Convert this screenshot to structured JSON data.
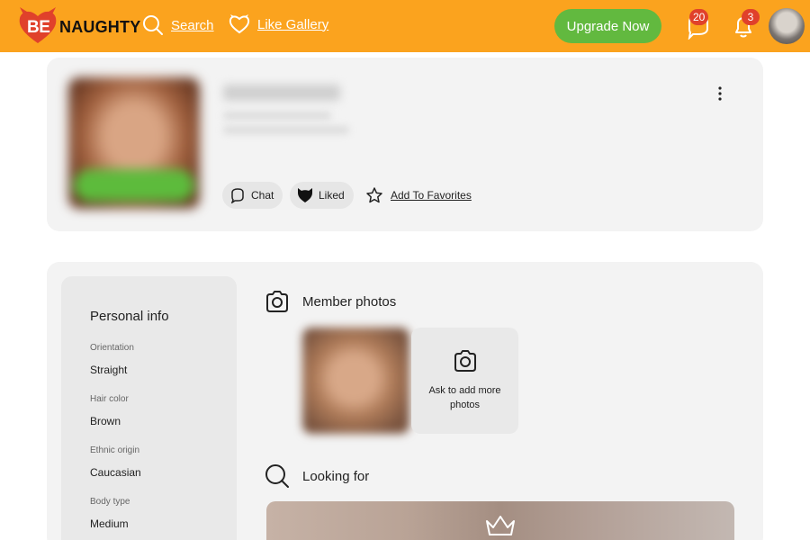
{
  "header": {
    "logo_be": "BE",
    "logo_naughty": "NAUGHTY",
    "search_label": "Search",
    "like_gallery_label": "Like Gallery",
    "upgrade_label": "Upgrade Now",
    "messages_count": "20",
    "notifications_count": "3",
    "brand_color": "#fba31e",
    "accent_green": "#62b93f",
    "badge_color": "#e0412b"
  },
  "profile": {
    "chat_label": "Chat",
    "liked_label": "Liked",
    "favorites_label": "Add To Favorites"
  },
  "personal_info": {
    "title": "Personal info",
    "fields": [
      {
        "label": "Orientation",
        "value": "Straight"
      },
      {
        "label": "Hair color",
        "value": "Brown"
      },
      {
        "label": "Ethnic origin",
        "value": "Caucasian"
      },
      {
        "label": "Body type",
        "value": "Medium"
      }
    ]
  },
  "member_photos": {
    "title": "Member photos",
    "ask_text": "Ask to add more photos"
  },
  "looking_for": {
    "title": "Looking for"
  },
  "icons": [
    "heart-devil-logo-icon",
    "search-icon",
    "heart-icon",
    "chat-icon",
    "bell-icon",
    "more-vertical-icon",
    "chat-bubble-icon",
    "cat-heart-icon",
    "star-icon",
    "camera-icon",
    "crown-icon"
  ]
}
